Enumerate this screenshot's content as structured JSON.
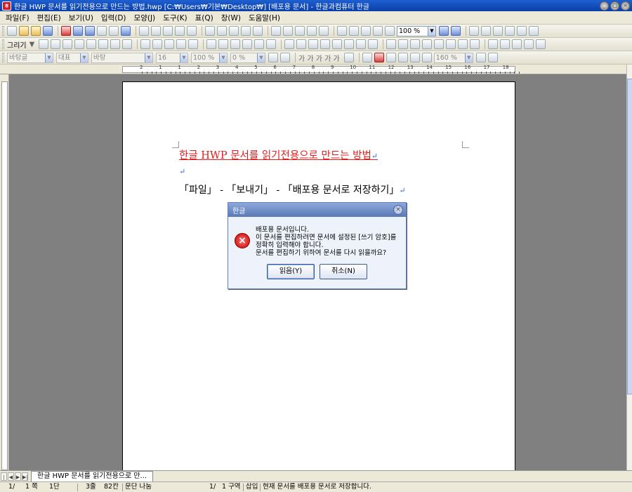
{
  "window": {
    "title": "한글 HWP 문서를 읽기전용으로 만드는 방법.hwp [C:₩Users₩기본₩Desktop₩] [배포용 문서] - 한글과컴퓨터 한글",
    "app_icon_glyph": "ㅎ",
    "minimize": "_",
    "maximize": "□",
    "close": "×"
  },
  "menu": [
    "파일(F)",
    "편집(E)",
    "보기(U)",
    "입력(D)",
    "모양(J)",
    "도구(K)",
    "표(Q)",
    "창(W)",
    "도움말(H)"
  ],
  "toolbar1": {
    "zoom": "100 %"
  },
  "toolbar2": {
    "draw_label": "그리기"
  },
  "toolbar3": {
    "style": "바탕글",
    "lang": "대표",
    "font": "바탕",
    "size": "16",
    "ratio": "100 %",
    "spacing": "0 %",
    "glyphs": "가  가  가  가  가",
    "line_spacing": "160 %"
  },
  "ruler": {
    "numbers": [
      "2",
      "1",
      "1",
      "2",
      "3",
      "4",
      "5",
      "6",
      "7",
      "8",
      "9",
      "10",
      "11",
      "12",
      "13",
      "14",
      "15",
      "16",
      "17",
      "18"
    ]
  },
  "document": {
    "title_line": "한글 HWP 문서를 읽기전용으로 만드는 방법",
    "body_line": "「파일」 - 「보내기」 - 「배포용 문서로 저장하기」",
    "para_mark": "↵"
  },
  "dialog": {
    "title": "한글",
    "close": "×",
    "icon": "×",
    "message": [
      "배포용 문서입니다.",
      "이 문서를 편집하려면 문서에 설정된 [쓰기 암호]를",
      "정확히 입력해야 합니다.",
      "문서를 편집하기 위하여 문서를 다시 읽을까요?"
    ],
    "ok_label": "읽음(Y)",
    "cancel_label": "취소(N)"
  },
  "tabs": {
    "active": "한글 HWP 문서를 읽기전용으로 만...",
    "first": "|◀",
    "prev": "◀",
    "next": "▶",
    "last": "▶|"
  },
  "status": {
    "page": "1/",
    "total_pages": "1 쪽",
    "column": "1단",
    "line": "3줄",
    "col_pos": "82칸",
    "break": "문단 나눔",
    "section": "1/",
    "section_label": "1 구역",
    "mode": "삽입",
    "message": "현재 문서를 배포용 문서로 저장합니다."
  }
}
